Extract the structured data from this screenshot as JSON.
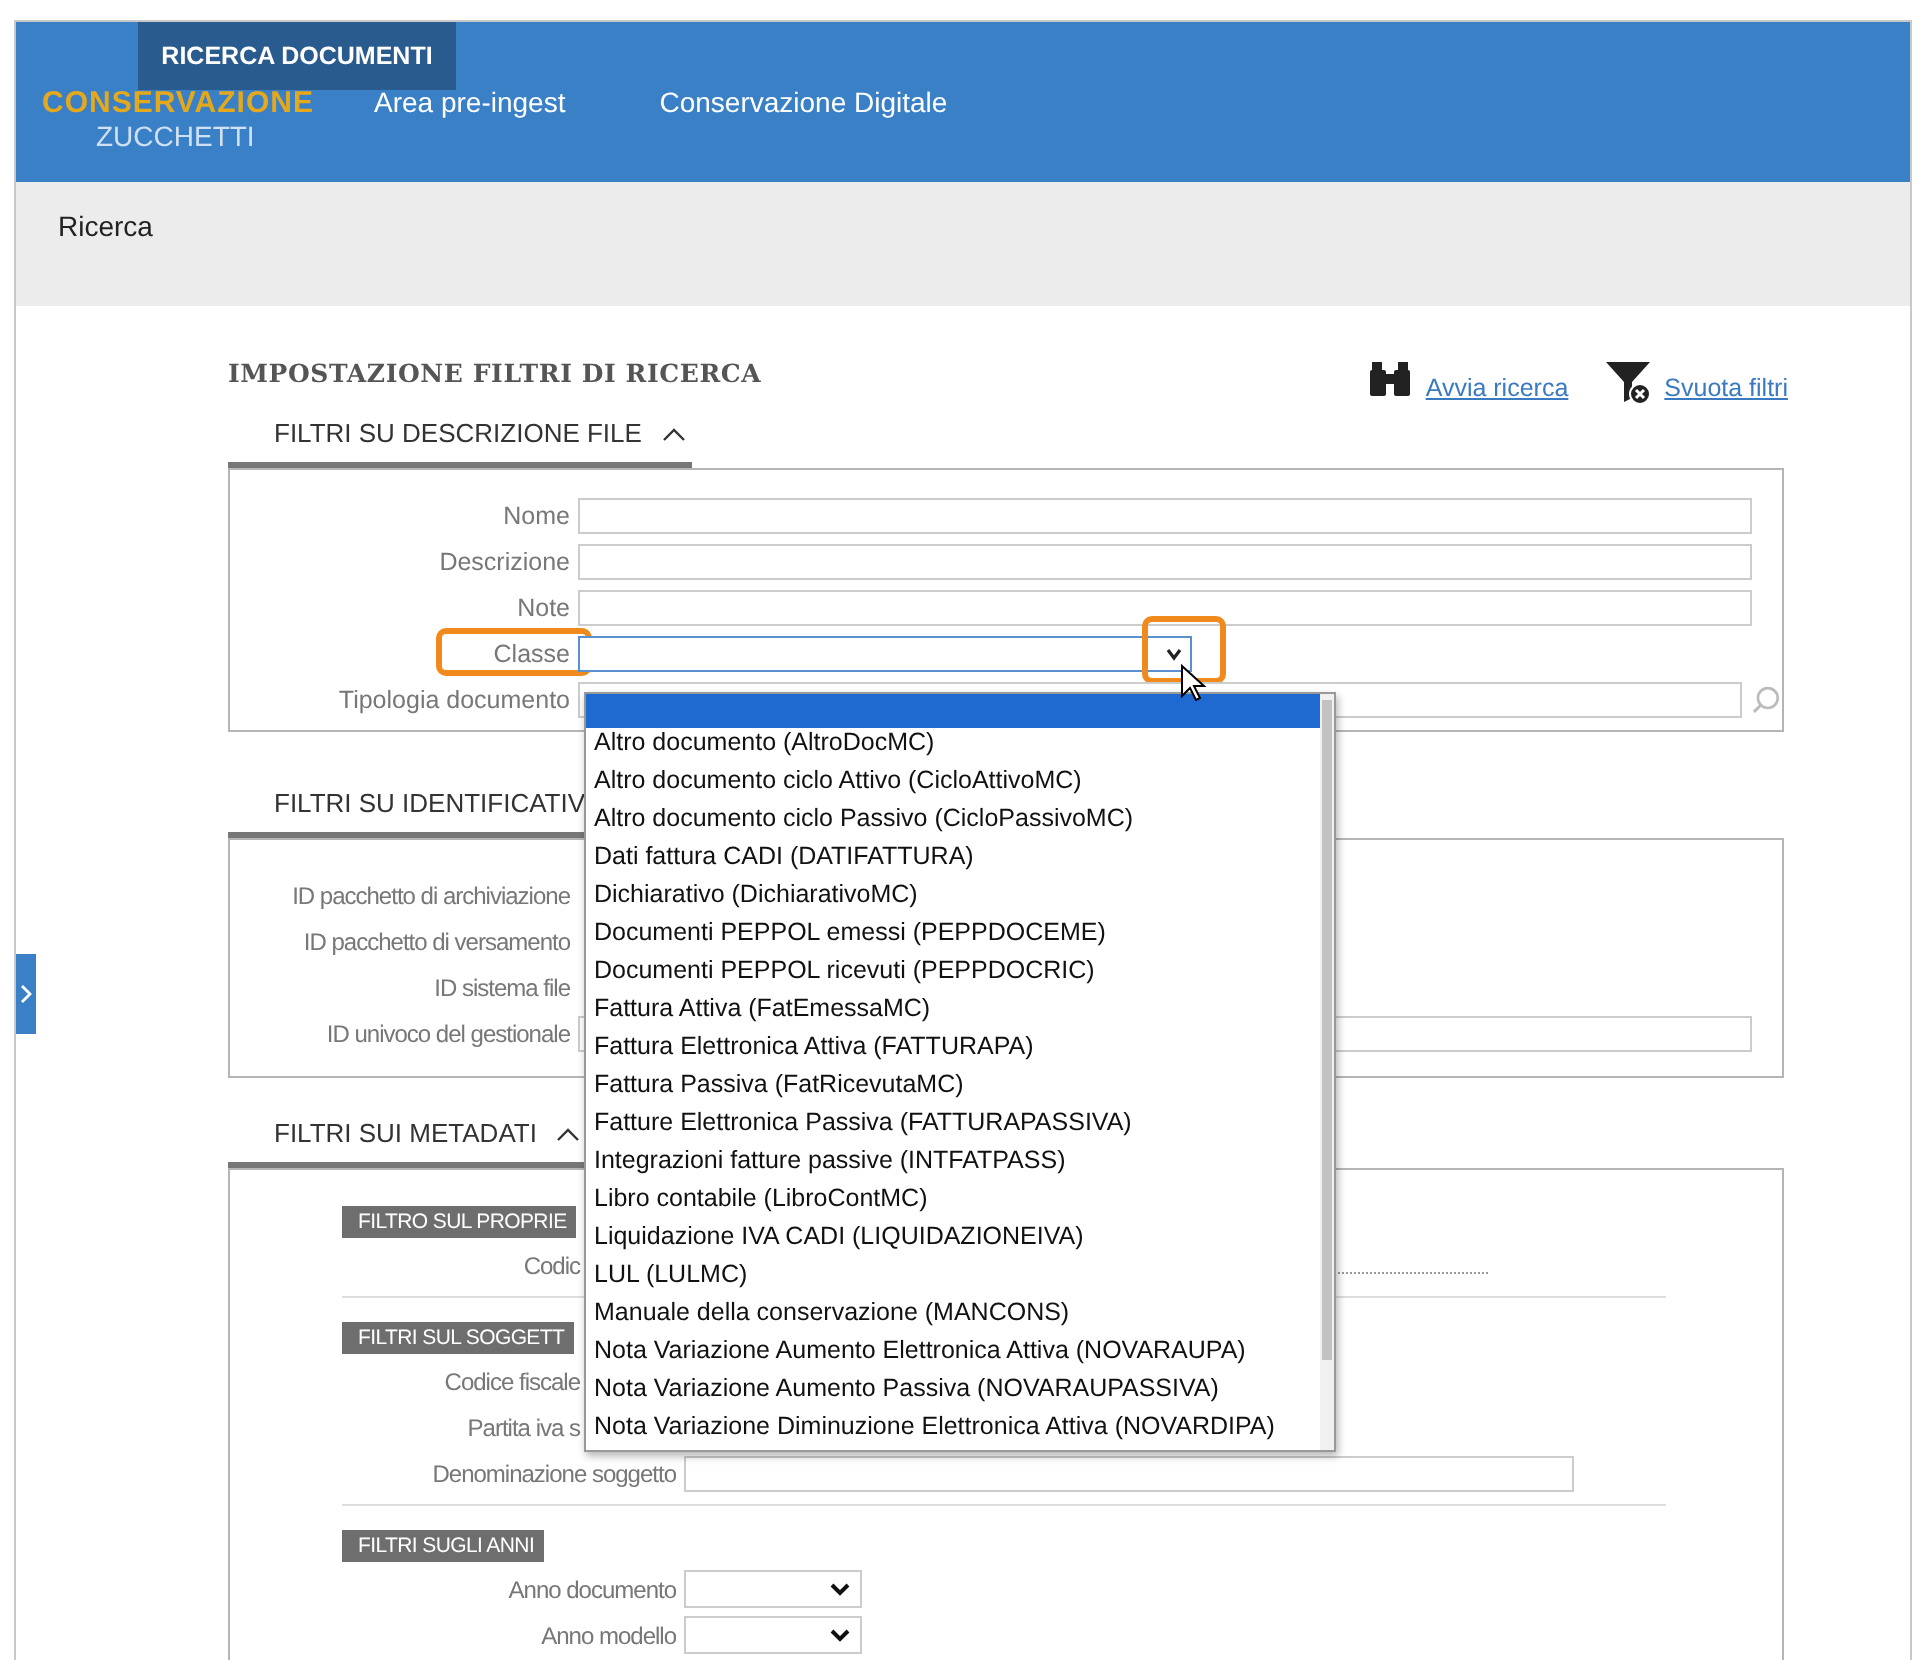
{
  "header": {
    "badge": "RICERCA DOCUMENTI",
    "logo_top": "CONSERVAZIONE",
    "logo_bottom": "ZUCCHETTI",
    "nav": [
      "Area pre-ingest",
      "Conservazione Digitale"
    ]
  },
  "breadcrumb": "Ricerca",
  "heading": "IMPOSTAZIONE FILTRI DI RICERCA",
  "actions": [
    {
      "label": "Avvia ricerca",
      "kind": "search"
    },
    {
      "label": "Svuota filtri",
      "kind": "clear"
    }
  ],
  "sections": [
    {
      "title": "FILTRI SU DESCRIZIONE FILE",
      "expanded": true,
      "fields": [
        {
          "label": "Nome",
          "kind": "text"
        },
        {
          "label": "Descrizione",
          "kind": "text"
        },
        {
          "label": "Note",
          "kind": "text"
        },
        {
          "label": "Classe",
          "kind": "select",
          "highlighted": true
        },
        {
          "label": "Tipologia documento",
          "kind": "lookup"
        }
      ]
    },
    {
      "title": "FILTRI SU IDENTIFICATIV",
      "fields": [
        {
          "label": "ID pacchetto di archiviazione",
          "kind": "covered"
        },
        {
          "label": "ID pacchetto di versamento",
          "kind": "covered"
        },
        {
          "label": "ID sistema file",
          "kind": "covered"
        },
        {
          "label": "ID univoco del gestionale",
          "kind": "text"
        }
      ]
    },
    {
      "title": "FILTRI SUI METADATI",
      "expanded": true,
      "groups": [
        {
          "title": "FILTRO SUL PROPRIE",
          "fields": [
            {
              "label": "Codic",
              "kind": "dotted"
            }
          ]
        },
        {
          "title": "FILTRI SUL SOGGETT",
          "fields": [
            {
              "label": "Codice fiscale",
              "kind": "covered"
            },
            {
              "label": "Partita iva s",
              "kind": "covered"
            },
            {
              "label": "Denominazione soggetto",
              "kind": "text"
            }
          ]
        },
        {
          "title": "FILTRI SUGLI ANNI",
          "fields": [
            {
              "label": "Anno documento",
              "kind": "year"
            },
            {
              "label": "Anno modello",
              "kind": "year"
            }
          ]
        }
      ]
    }
  ],
  "dropdown": {
    "options": [
      {
        "selected": true
      },
      {
        "label": "Altro documento (AltroDocMC)",
        "selected": false
      },
      {
        "label": "Altro documento ciclo Attivo (CicloAttivoMC)",
        "selected": false
      },
      {
        "label": "Altro documento ciclo Passivo (CicloPassivoMC)",
        "selected": false
      },
      {
        "label": "Dati fattura CADI (DATIFATTURA)",
        "selected": false
      },
      {
        "label": "Dichiarativo (DichiarativoMC)",
        "selected": false
      },
      {
        "label": "Documenti PEPPOL emessi (PEPPDOCEME)",
        "selected": false
      },
      {
        "label": "Documenti PEPPOL ricevuti (PEPPDOCRIC)",
        "selected": false
      },
      {
        "label": "Fattura Attiva (FatEmessaMC)",
        "selected": false
      },
      {
        "label": "Fattura Elettronica Attiva (FATTURAPA)",
        "selected": false
      },
      {
        "label": "Fattura Passiva (FatRicevutaMC)",
        "selected": false
      },
      {
        "label": "Fatture Elettronica Passiva (FATTURAPASSIVA)",
        "selected": false
      },
      {
        "label": "Integrazioni fatture passive (INTFATPASS)",
        "selected": false
      },
      {
        "label": "Libro contabile (LibroContMC)",
        "selected": false
      },
      {
        "label": "Liquidazione IVA CADI (LIQUIDAZIONEIVA)",
        "selected": false
      },
      {
        "label": "LUL (LULMC)",
        "selected": false
      },
      {
        "label": "Manuale della conservazione (MANCONS)",
        "selected": false
      },
      {
        "label": "Nota Variazione Aumento Elettronica Attiva (NOVARAUPA)",
        "selected": false
      },
      {
        "label": "Nota Variazione Aumento Passiva (NOVARAUPASSIVA)",
        "selected": false
      },
      {
        "label": "Nota Variazione Diminuzione Elettronica Attiva (NOVARDIPA)",
        "selected": false
      }
    ]
  }
}
